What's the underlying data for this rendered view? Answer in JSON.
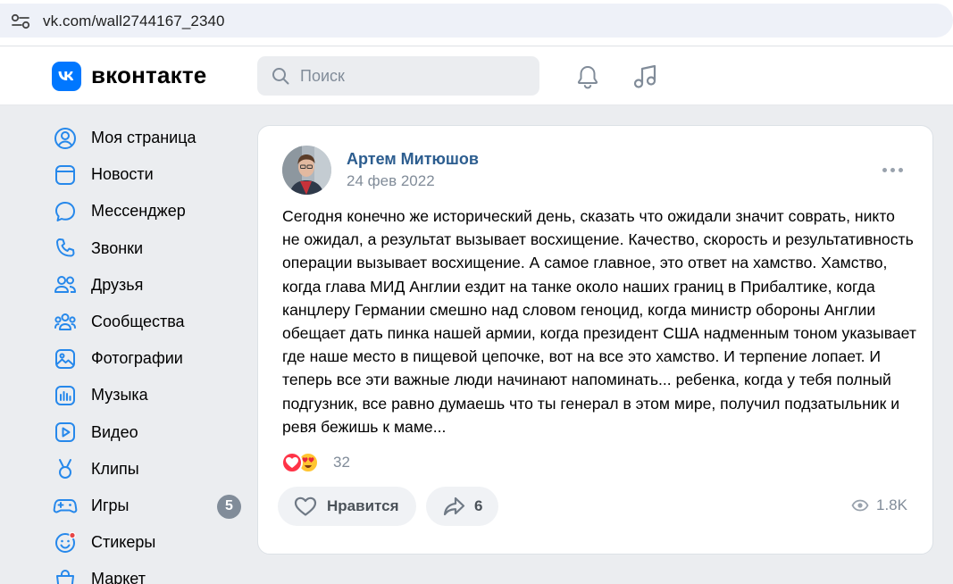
{
  "browser": {
    "url": "vk.com/wall2744167_2340"
  },
  "header": {
    "logo_text": "вконтакте",
    "search_placeholder": "Поиск"
  },
  "sidebar": {
    "items": [
      {
        "label": "Моя страница",
        "icon": "profile-icon"
      },
      {
        "label": "Новости",
        "icon": "newsfeed-icon"
      },
      {
        "label": "Мессенджер",
        "icon": "messenger-icon"
      },
      {
        "label": "Звонки",
        "icon": "phone-icon"
      },
      {
        "label": "Друзья",
        "icon": "friends-icon"
      },
      {
        "label": "Сообщества",
        "icon": "communities-icon"
      },
      {
        "label": "Фотографии",
        "icon": "photos-icon"
      },
      {
        "label": "Музыка",
        "icon": "music-icon"
      },
      {
        "label": "Видео",
        "icon": "video-icon"
      },
      {
        "label": "Клипы",
        "icon": "clips-icon"
      },
      {
        "label": "Игры",
        "icon": "games-icon",
        "badge": "5"
      },
      {
        "label": "Стикеры",
        "icon": "stickers-icon"
      },
      {
        "label": "Маркет",
        "icon": "market-icon"
      }
    ]
  },
  "post": {
    "author": "Артем Митюшов",
    "date": "24 фев 2022",
    "text": "Сегодня конечно же исторический день, сказать что ожидали значит соврать, никто не ожидал, а результат вызывает восхищение. Качество, скорость и результативность операции вызывает восхищение. А самое главное, это ответ на хамство. Хамство, когда глава МИД Англии ездит на танке около наших границ в Прибалтике, когда канцлеру Германии смешно над словом геноцид, когда министр обороны Англии обещает дать пинка нашей армии, когда президент США надменным тоном указывает где наше место в пищевой цепочке, вот на все это хамство. И терпение лопает. И теперь все эти важные люди начинают напоминать... ребенка, когда у тебя полный подгузник, все равно думаешь что ты генерал в этом мире, получил подзатыльник и ревя бежишь к маме...",
    "reactions_count": "32",
    "like_label": "Нравится",
    "shares_count": "6",
    "views_count": "1.8K"
  },
  "colors": {
    "accent": "#0077ff",
    "author_link": "#2c5d8f",
    "page_bg": "#ebedf0",
    "secondary_text": "#818c99"
  }
}
